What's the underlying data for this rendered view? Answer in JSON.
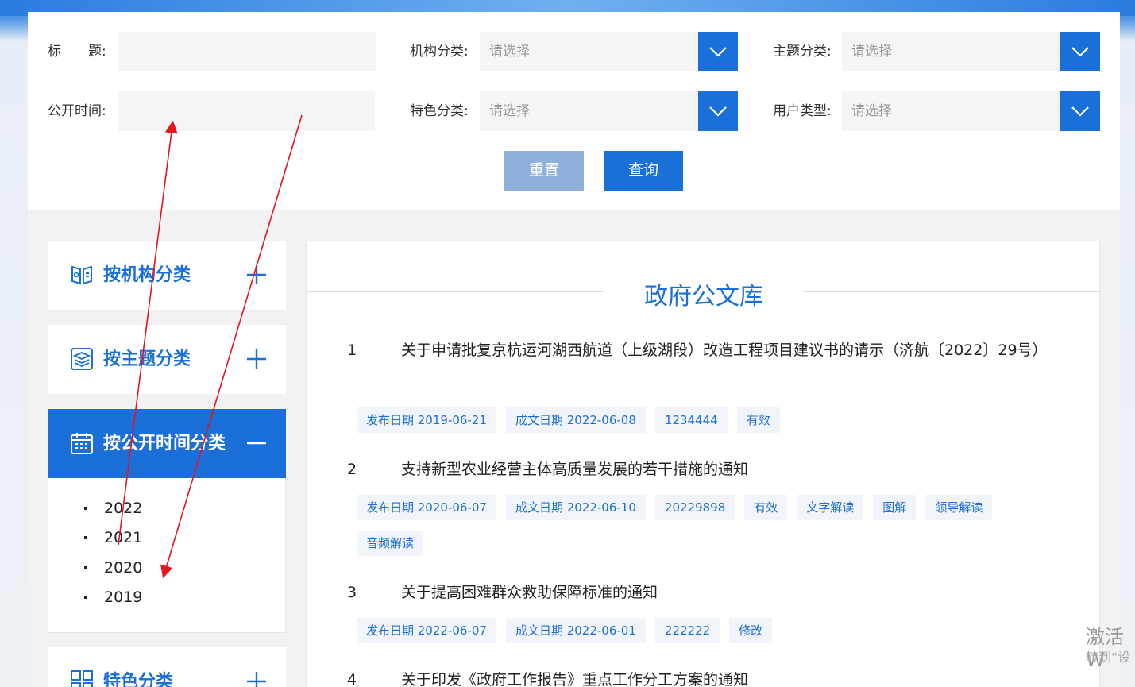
{
  "search": {
    "title_label": "标　　题:",
    "title_value": "",
    "org_label": "机构分类:",
    "org_value": "请选择",
    "topic_label": "主题分类:",
    "topic_value": "请选择",
    "time_label": "公开时间:",
    "time_value": "",
    "feature_label": "特色分类:",
    "feature_value": "请选择",
    "user_label": "用户类型:",
    "user_value": "请选择",
    "reset_label": "重置",
    "query_label": "查询"
  },
  "sidebar": {
    "items": [
      {
        "label": "按机构分类",
        "icon": "book-icon",
        "state": "collapsed"
      },
      {
        "label": "按主题分类",
        "icon": "layers-icon",
        "state": "collapsed"
      },
      {
        "label": "按公开时间分类",
        "icon": "calendar-icon",
        "state": "expanded"
      },
      {
        "label": "特色分类",
        "icon": "grid-icon",
        "state": "collapsed"
      }
    ],
    "years": [
      "2022",
      "2021",
      "2020",
      "2019"
    ]
  },
  "main": {
    "title": "政府公文库",
    "docs": [
      {
        "num": "1",
        "title": "关于申请批复京杭运河湖西航道（上级湖段）改造工程项目建议书的请示（济航〔2022〕29号）",
        "tags": [
          "发布日期 2019-06-21",
          "成文日期 2022-06-08",
          "1234444",
          "有效"
        ]
      },
      {
        "num": "2",
        "title": "支持新型农业经营主体高质量发展的若干措施的通知",
        "tags": [
          "发布日期 2020-06-07",
          "成文日期 2022-06-10",
          "20229898",
          "有效",
          "文字解读",
          "图解",
          "领导解读",
          "音频解读"
        ]
      },
      {
        "num": "3",
        "title": "关于提高困难群众救助保障标准的通知",
        "tags": [
          "发布日期 2022-06-07",
          "成文日期 2022-06-01",
          "222222",
          "修改"
        ]
      },
      {
        "num": "4",
        "title": "关于印发《政府工作报告》重点工作分工方案的通知",
        "tags": []
      }
    ]
  },
  "watermark": {
    "line1": "激活 W",
    "line2": "转到“设"
  },
  "colors": {
    "accent": "#1a6fd8",
    "reset": "#8fb0d9",
    "annotation": "#e8141c"
  }
}
